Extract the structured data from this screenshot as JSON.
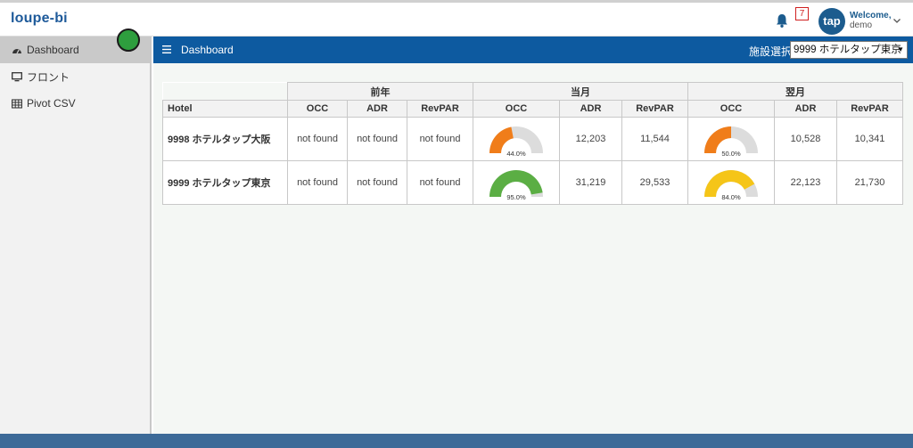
{
  "app": {
    "logo": "loupe-bi"
  },
  "topbar": {
    "notification_count": "7",
    "avatar_text": "tap",
    "welcome": "Welcome,",
    "username": "demo"
  },
  "sidebar": {
    "items": [
      {
        "label": "Dashboard",
        "icon": "tachometer-icon",
        "active": true
      },
      {
        "label": "フロント",
        "icon": "desktop-icon",
        "active": false
      },
      {
        "label": "Pivot CSV",
        "icon": "table-icon",
        "active": false
      }
    ]
  },
  "header": {
    "title": "Dashboard",
    "facility_label": "施設選択",
    "facility_value": "9999 ホテルタップ東京"
  },
  "table": {
    "groups": [
      "前年",
      "当月",
      "翌月"
    ],
    "columns": [
      "Hotel",
      "OCC",
      "ADR",
      "RevPAR",
      "OCC",
      "ADR",
      "RevPAR",
      "OCC",
      "ADR",
      "RevPAR"
    ],
    "rows": [
      {
        "hotel": "9998 ホテルタップ大阪",
        "prev": {
          "occ": "not found",
          "adr": "not found",
          "revpar": "not found"
        },
        "cur": {
          "occ_label": "44.0%",
          "occ_value": 44.0,
          "occ_color": "#f07d1a",
          "adr": "12,203",
          "revpar": "11,544"
        },
        "next": {
          "occ_label": "50.0%",
          "occ_value": 50.0,
          "occ_color": "#f07d1a",
          "adr": "10,528",
          "revpar": "10,341"
        }
      },
      {
        "hotel": "9999 ホテルタップ東京",
        "prev": {
          "occ": "not found",
          "adr": "not found",
          "revpar": "not found"
        },
        "cur": {
          "occ_label": "95.0%",
          "occ_value": 95.0,
          "occ_color": "#5bae44",
          "adr": "31,219",
          "revpar": "29,533"
        },
        "next": {
          "occ_label": "84.0%",
          "occ_value": 84.0,
          "occ_color": "#f5c518",
          "adr": "22,123",
          "revpar": "21,730"
        }
      }
    ]
  },
  "colors": {
    "brand": "#1e5a9a",
    "header_bg": "#0d5aa0",
    "gauge_track": "#dcdcdc"
  }
}
